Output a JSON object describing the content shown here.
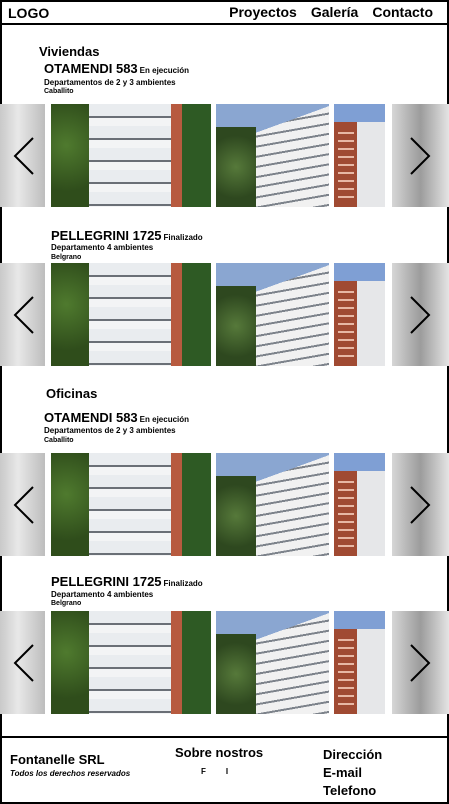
{
  "header": {
    "logo": "LOGO",
    "nav": [
      "Proyectos",
      "Galería",
      "Contacto"
    ]
  },
  "sections": [
    {
      "title": "Viviendas",
      "projects": [
        {
          "name": "OTAMENDI 583",
          "status": "En ejecución",
          "description": "Departamentos de 2 y 3 ambientes",
          "location": "Caballito"
        },
        {
          "name": "PELLEGRINI 1725",
          "status": "Finalizado",
          "description": "Departamento 4 ambientes",
          "location": "Belgrano"
        }
      ]
    },
    {
      "title": "Oficinas",
      "projects": [
        {
          "name": "OTAMENDI 583",
          "status": "En ejecución",
          "description": "Departamentos de 2 y 3 ambientes",
          "location": "Caballito"
        },
        {
          "name": "PELLEGRINI 1725",
          "status": "Finalizado",
          "description": "Departamento 4 ambientes",
          "location": "Belgrano"
        }
      ]
    }
  ],
  "icons": {
    "prev": "chevron-left-icon",
    "next": "chevron-right-icon"
  },
  "footer": {
    "company": "Fontanelle SRL",
    "rights": "Todos los derechos reservados",
    "about": "Sobre nostros",
    "social": [
      "F",
      "I"
    ],
    "contact": [
      "Dirección",
      "E-mail",
      "Telefono"
    ]
  }
}
